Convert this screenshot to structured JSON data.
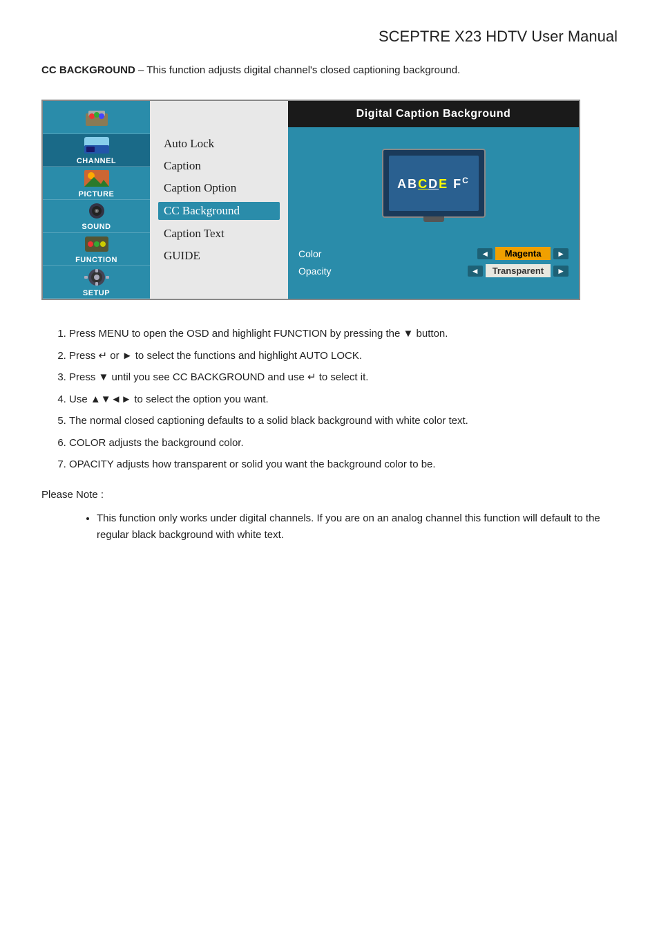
{
  "page": {
    "title": "SCEPTRE X23 HDTV User Manual",
    "intro_bold": "CC BACKGROUND",
    "intro_text": " – This function adjusts digital channel's closed captioning background."
  },
  "osd": {
    "sidebar": {
      "items": [
        {
          "id": "autolock",
          "label": ""
        },
        {
          "id": "channel",
          "label": "CHANNEL"
        },
        {
          "id": "picture",
          "label": "PICTURE"
        },
        {
          "id": "sound",
          "label": "SOUND"
        },
        {
          "id": "function",
          "label": "FUNCTION"
        },
        {
          "id": "setup",
          "label": "SETUP"
        }
      ]
    },
    "menu": {
      "items": [
        {
          "label": "Auto Lock",
          "highlighted": false
        },
        {
          "label": "Caption",
          "highlighted": false
        },
        {
          "label": "Caption Option",
          "highlighted": false
        },
        {
          "label": "CC Background",
          "highlighted": true
        },
        {
          "label": "Caption Text",
          "highlighted": false
        },
        {
          "label": "GUIDE",
          "highlighted": false
        }
      ]
    },
    "caption_panel": {
      "header": "Digital Caption Background",
      "tv_text": "ABCDEF",
      "options": [
        {
          "label": "Color",
          "value": "Magenta",
          "value_type": "magenta"
        },
        {
          "label": "Opacity",
          "value": "Transparent",
          "value_type": "transparent"
        }
      ]
    }
  },
  "instructions": {
    "steps": [
      "Press MENU to open the OSD and highlight FUNCTION by pressing the ▼ button.",
      "Press ↵ or ► to select the functions and highlight AUTO LOCK.",
      "Press ▼ until you see CC BACKGROUND and use ↵ to select it.",
      "Use ▲▼◄► to select the option you want.",
      "The normal closed captioning defaults to a solid black background with white color text.",
      "COLOR adjusts the background color.",
      "OPACITY adjusts how transparent or solid you want the background color to be."
    ],
    "note_label": "Please Note :",
    "note_bullets": [
      "This function only works under digital channels.  If you are on an analog channel this function will default to the regular black background with white text."
    ]
  }
}
